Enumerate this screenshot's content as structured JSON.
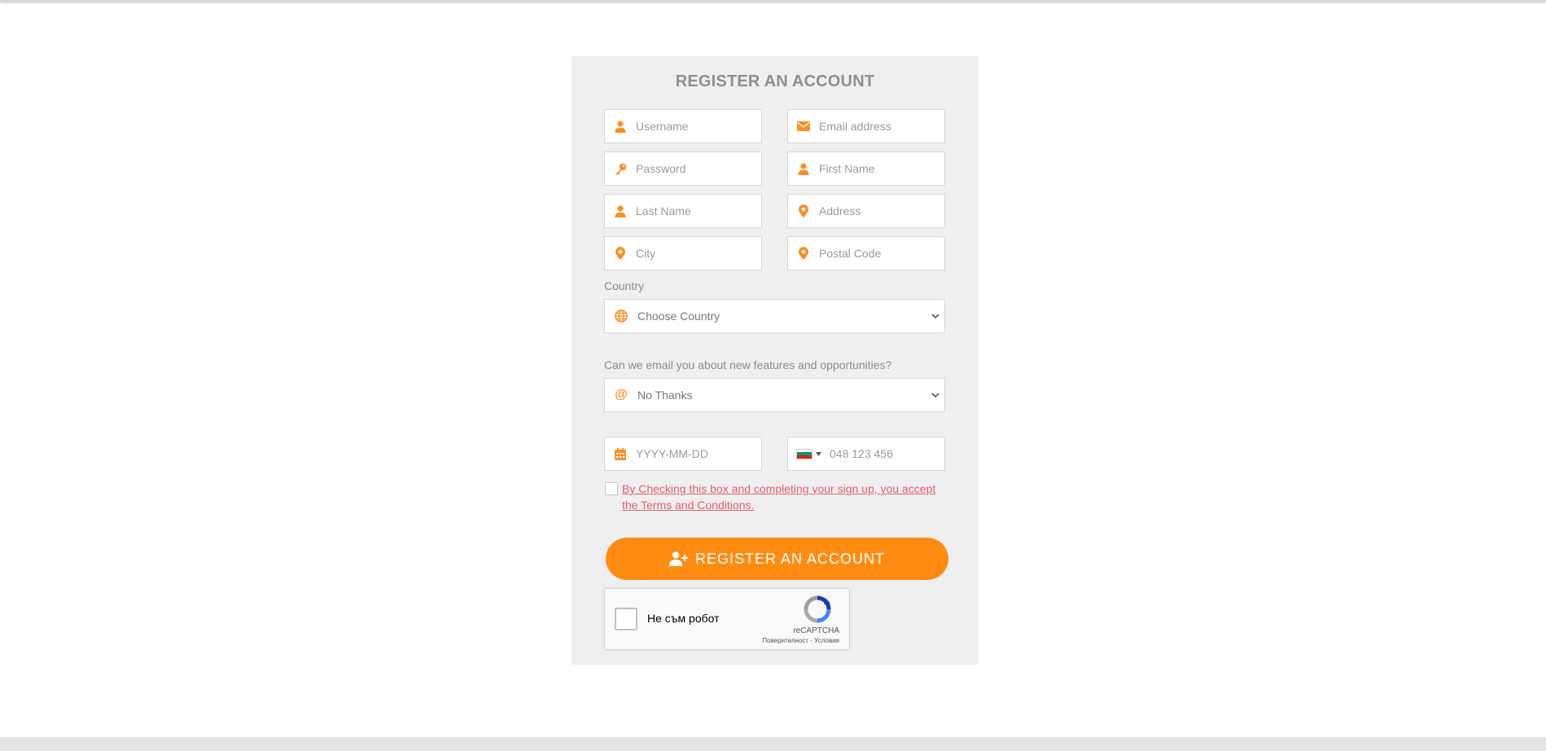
{
  "form": {
    "title": "REGISTER AN ACCOUNT",
    "fields": {
      "username": "Username",
      "email": "Email address",
      "password": "Password",
      "first_name": "First Name",
      "last_name": "Last Name",
      "address": "Address",
      "city": "City",
      "postal_code": "Postal Code",
      "birthdate": "YYYY-MM-DD",
      "phone": "048 123 456"
    },
    "country": {
      "label": "Country",
      "selected": "Choose Country"
    },
    "marketing": {
      "label": "Can we email you about new features and opportunities?",
      "selected": "No Thanks"
    },
    "terms_text": "By Checking this box and completing your sign up, you accept the Terms and Conditions.",
    "register_button": "REGISTER AN ACCOUNT"
  },
  "captcha": {
    "label": "Не съм робот",
    "brand": "reCAPTCHA",
    "links": "Поверителност - Условия"
  },
  "colors": {
    "accent": "#ff8c12",
    "panel_bg": "#efeff0",
    "terms_link": "#e0606c"
  },
  "icons": {
    "username": "user-icon",
    "email": "envelope-icon",
    "password": "key-icon",
    "first_name": "user-icon",
    "last_name": "user-icon",
    "address": "map-pin-icon",
    "city": "map-pin-icon",
    "postal_code": "map-pin-icon",
    "country": "globe-icon",
    "marketing": "at-sign-icon",
    "birthdate": "calendar-icon",
    "phone_flag": "bulgaria-flag-icon"
  }
}
